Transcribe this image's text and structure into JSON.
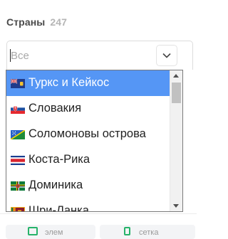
{
  "filter": {
    "title": "Страны",
    "count": "247"
  },
  "search": {
    "placeholder": "Все",
    "value": ""
  },
  "dropdown": {
    "options": [
      {
        "label": "Туркс и Кейкос",
        "flag": "flag-turks-and-caicos",
        "selected": true
      },
      {
        "label": "Словакия",
        "flag": "flag-slovakia",
        "selected": false
      },
      {
        "label": "Соломоновы острова",
        "flag": "flag-solomon-islands",
        "selected": false
      },
      {
        "label": "Коста-Рика",
        "flag": "flag-costa-rica",
        "selected": false
      },
      {
        "label": "Доминика",
        "flag": "flag-dominica",
        "selected": false
      },
      {
        "label": "Шри-Ланка",
        "flag": "flag-sri-lanka",
        "selected": false
      }
    ],
    "selected_color": "#5596f5"
  },
  "footer": {
    "left_button": "элем",
    "right_button": "сетка"
  },
  "colors": {
    "accent": "#5596f5",
    "icon_green": "#27b36a"
  }
}
